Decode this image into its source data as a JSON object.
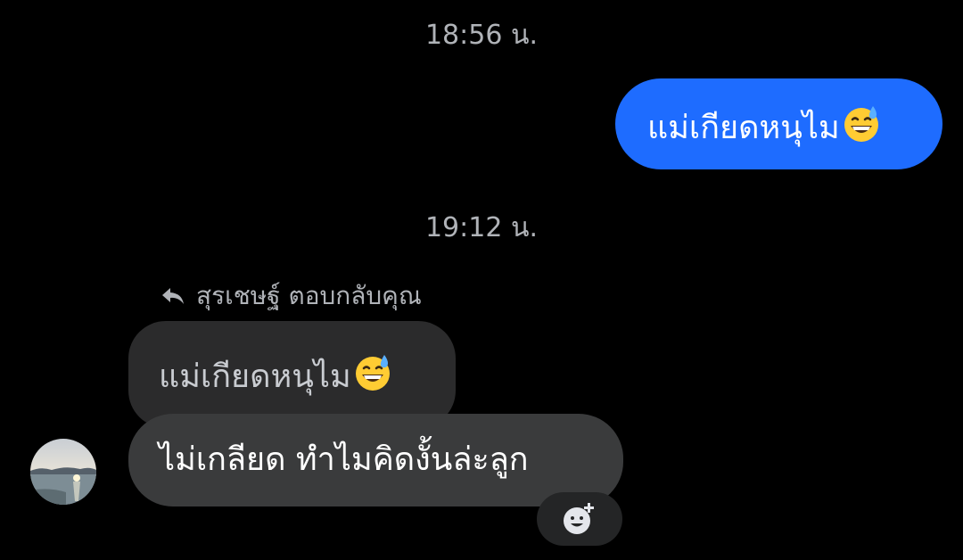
{
  "conversation": {
    "messages_block_1": {
      "timestamp": "18:56 น."
    },
    "outgoing_message": {
      "text": "แม่เกียดหนุไม",
      "emoji": "grinning-face-with-sweat-emoji",
      "color": "#1e6cff"
    },
    "messages_block_2": {
      "timestamp": "19:12 น."
    },
    "reply_header": {
      "icon": "reply-arrow-icon",
      "text": "สุรเชษฐ์ ตอบกลับคุณ"
    },
    "quoted_message": {
      "text": "แม่เกียดหนุไม",
      "emoji": "grinning-face-with-sweat-emoji"
    },
    "incoming_message": {
      "text": "ไม่เกลียด ทำไมคิดงั้นล่ะลูก",
      "sender_avatar": "avatar"
    },
    "reaction_button": {
      "icon": "add-reaction-icon"
    }
  }
}
